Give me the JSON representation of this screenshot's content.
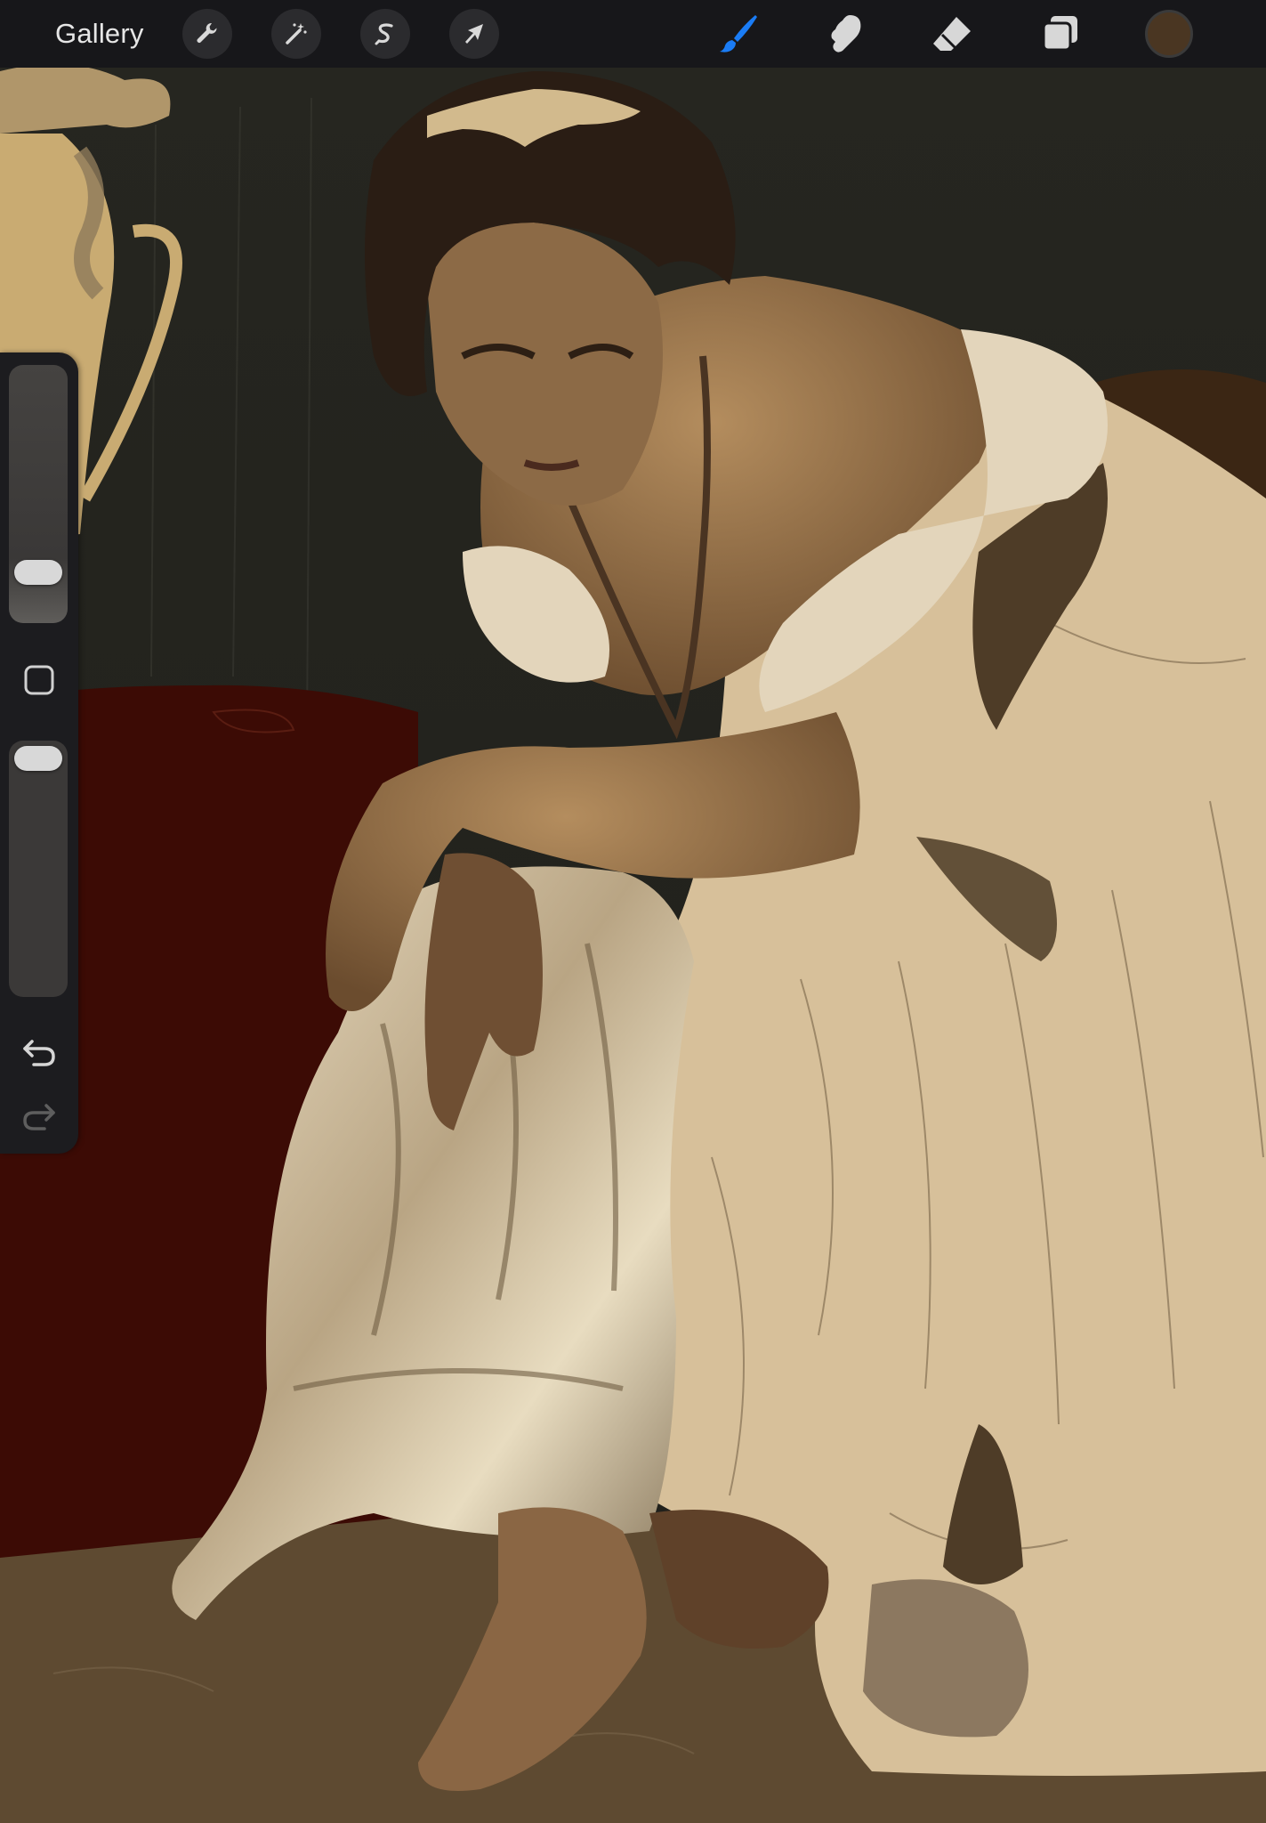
{
  "toolbar": {
    "gallery_label": "Gallery",
    "left_tools": [
      {
        "name": "actions",
        "icon": "wrench-icon"
      },
      {
        "name": "adjustments",
        "icon": "magic-wand-icon"
      },
      {
        "name": "selection",
        "icon": "selection-s-icon"
      },
      {
        "name": "transform",
        "icon": "cursor-arrow-icon"
      }
    ],
    "right_tools": [
      {
        "name": "brush",
        "icon": "brush-icon",
        "active": true
      },
      {
        "name": "smudge",
        "icon": "smudge-finger-icon",
        "active": false
      },
      {
        "name": "eraser",
        "icon": "eraser-icon",
        "active": false
      },
      {
        "name": "layers",
        "icon": "layers-icon",
        "active": false
      }
    ],
    "current_color": "#4a3622",
    "active_color": "#1a7cf5",
    "inactive_color": "#d7d7d7"
  },
  "sidebar": {
    "brush_size": 0.15,
    "brush_opacity": 1.0,
    "modify_icon": "square-outline-icon",
    "undo_icon": "undo-arrow-icon",
    "redo_icon": "redo-arrow-icon"
  },
  "canvas": {
    "subject": "painting-in-progress",
    "palette": {
      "wall": "#23231e",
      "sofa": "#3e0c05",
      "floor": "#5e4a31",
      "vase": "#c9ab72",
      "dress": "#d7c09a",
      "skin": "#8a6a45",
      "hair": "#2a1d14"
    }
  }
}
